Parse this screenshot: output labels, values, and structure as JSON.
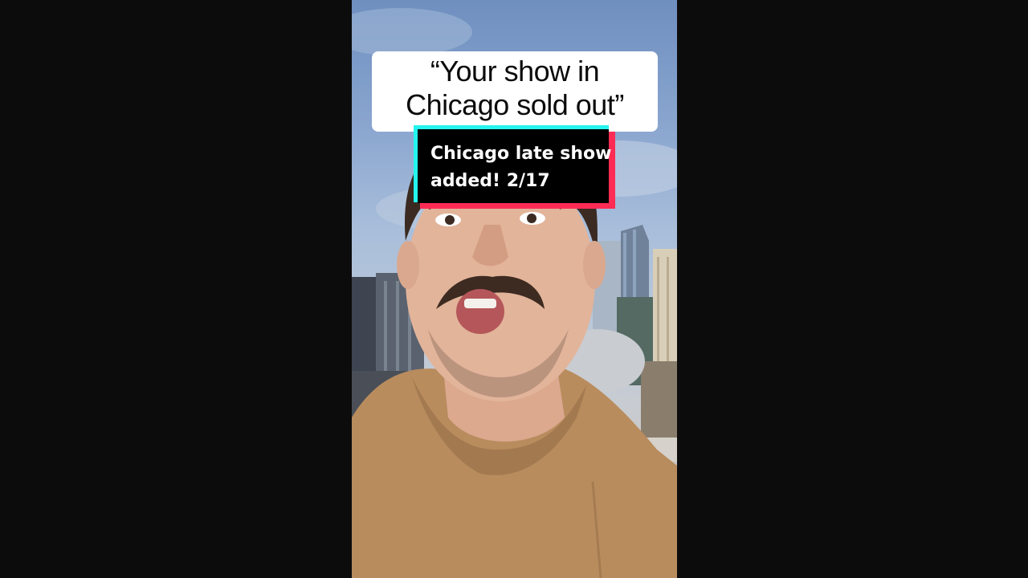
{
  "video": {
    "caption": {
      "line1": "“Your show in",
      "line2": "Chicago sold out”"
    },
    "sticker": {
      "line1": "Chicago late show",
      "line2": "added! 2/17"
    }
  },
  "colors": {
    "page_background": "#0c0c0d",
    "caption_background": "#ffffff",
    "sticker_background": "#000000",
    "sticker_accent_cyan": "#25f4ee",
    "sticker_accent_red": "#fe2c55",
    "hoodie": "#b98c5e"
  }
}
